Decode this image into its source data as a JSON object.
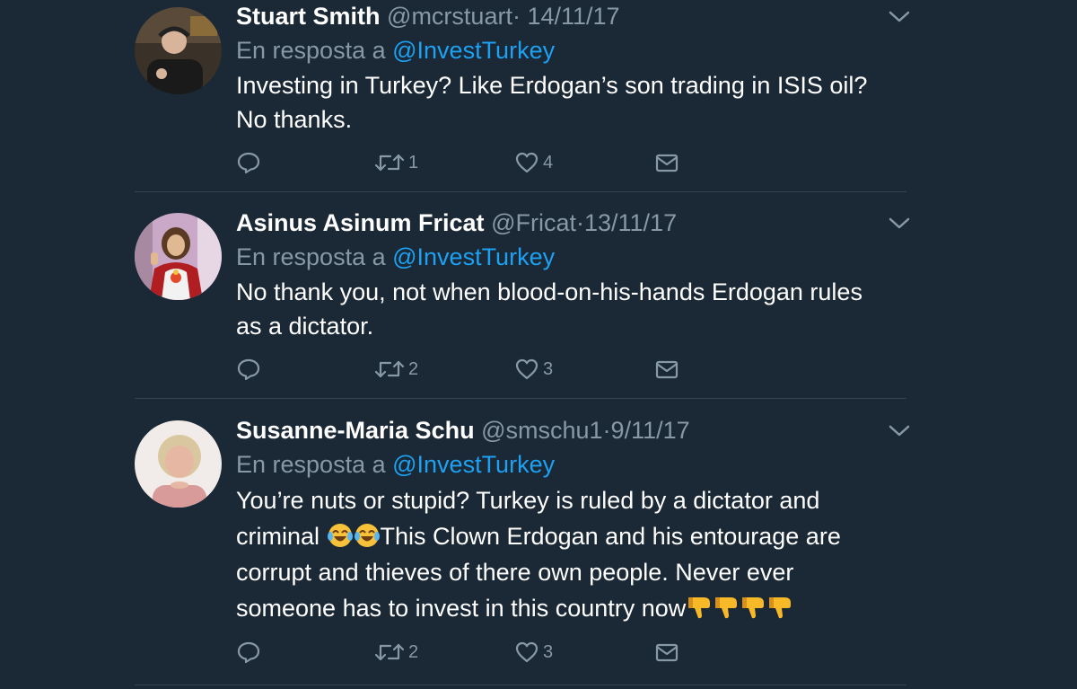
{
  "tweets": [
    {
      "name": "Stuart Smith",
      "handle": "@mcrstuart",
      "dot": "·",
      "date": "14/11/17",
      "reply_prefix": "En resposta a",
      "reply_to": "@InvestTurkey",
      "body_lines": [
        "Investing in Turkey? Like Erdogan’s son trading in ISIS oil?",
        "No thanks."
      ],
      "retweets": "1",
      "likes": "4"
    },
    {
      "name": "Asinus Asinum Fricat",
      "handle": "@Fricat",
      "dot": "·",
      "date": "13/11/17",
      "reply_prefix": "En resposta a",
      "reply_to": "@InvestTurkey",
      "body_lines": [
        "No thank you, not when blood-on-his-hands Erdogan rules",
        "as a dictator."
      ],
      "retweets": "2",
      "likes": "3"
    },
    {
      "name": "Susanne-Maria Schu",
      "handle": "@smschu1",
      "dot": "·",
      "date": "9/11/17",
      "reply_prefix": "En resposta a",
      "reply_to": "@InvestTurkey",
      "body_line1": "You’re nuts or stupid? Turkey is ruled by a dictator and",
      "body_line2_a": "criminal ",
      "body_line2_b": "This Clown Erdogan and his entourage are",
      "body_line3": "corrupt and thieves of there own people. Never ever",
      "body_line4": "someone has to invest in this country now",
      "retweets": "2",
      "likes": "3"
    }
  ],
  "icons": {
    "reply": "reply-icon",
    "retweet": "retweet-icon",
    "like": "heart-icon",
    "dm": "envelope-icon",
    "more": "chevron-down-icon",
    "laugh": "tears-of-joy-emoji",
    "thumbs_down": "thumbs-down-emoji"
  },
  "colors": {
    "background": "#1b2836",
    "text": "#ffffff",
    "muted": "#8899a6",
    "link": "#1da1f2",
    "divider": "#38444d"
  }
}
